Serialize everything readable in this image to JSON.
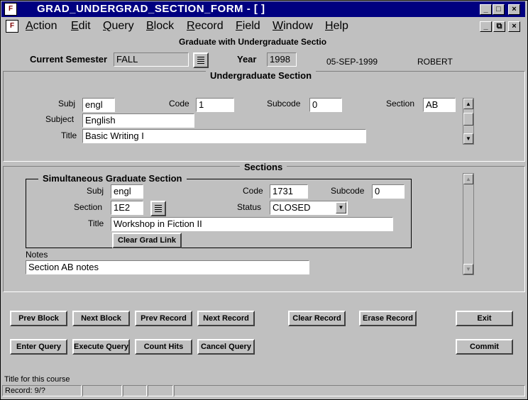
{
  "window": {
    "title": "GRAD_UNDERGRAD_SECTION_FORM - [ ]",
    "app_icon": "oracle-forms-icon",
    "controls": {
      "minimize": "_",
      "maximize": "□",
      "close": "×",
      "restore": "⧉"
    }
  },
  "menu": {
    "items": [
      {
        "label": "Action"
      },
      {
        "label": "Edit"
      },
      {
        "label": "Query"
      },
      {
        "label": "Block"
      },
      {
        "label": "Record"
      },
      {
        "label": "Field"
      },
      {
        "label": "Window"
      },
      {
        "label": "Help"
      }
    ]
  },
  "form": {
    "heading": "Graduate with Undergraduate Sectio",
    "current_semester_label": "Current Semester",
    "current_semester": "FALL",
    "year_label": "Year",
    "year": "1998",
    "date": "05-SEP-1999",
    "user": "ROBERT"
  },
  "undergrad": {
    "header": "Undergraduate Section",
    "subj_label": "Subj",
    "subj": "engl",
    "code_label": "Code",
    "code": "1",
    "subcode_label": "Subcode",
    "subcode": "0",
    "section_label": "Section",
    "section": "AB",
    "subject_label": "Subject",
    "subject": "English",
    "title_label": "Title",
    "title": "Basic Writing I"
  },
  "sections": {
    "header": "Sections",
    "grad_header": "Simultaneous Graduate Section",
    "subj_label": "Subj",
    "subj": "engl",
    "code_label": "Code",
    "code": "1731",
    "subcode_label": "Subcode",
    "subcode": "0",
    "section_label": "Section",
    "section": "1E2",
    "status_label": "Status",
    "status": "CLOSED",
    "title_label": "Title",
    "title": "Workshop in Fiction II",
    "clear_grad_link": "Clear Grad Link",
    "notes_label": "Notes",
    "notes": "Section AB notes"
  },
  "buttons": {
    "prev_block": "Prev Block",
    "next_block": "Next Block",
    "prev_record": "Prev Record",
    "next_record": "Next Record",
    "clear_record": "Clear Record",
    "erase_record": "Erase Record",
    "exit": "Exit",
    "enter_query": "Enter Query",
    "execute_query": "Execute Query",
    "count_hits": "Count Hits",
    "cancel_query": "Cancel Query",
    "commit": "Commit"
  },
  "statusbar": {
    "hint": "Title for this course",
    "record": "Record: 9/?"
  }
}
